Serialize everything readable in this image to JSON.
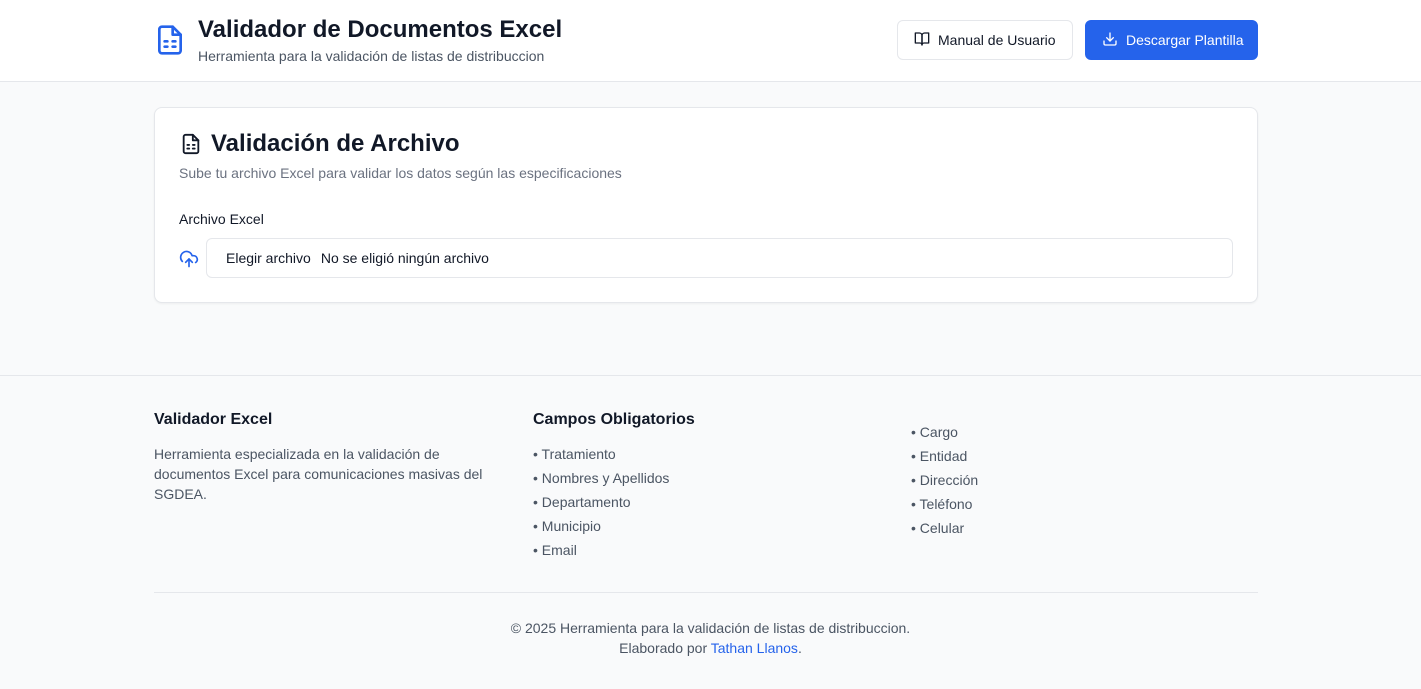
{
  "header": {
    "title": "Validador de Documentos Excel",
    "subtitle": "Herramienta para la validación de listas de distribuccion",
    "manual_button": "Manual de Usuario",
    "download_button": "Descargar Plantilla"
  },
  "card": {
    "title": "Validación de Archivo",
    "description": "Sube tu archivo Excel para validar los datos según las especificaciones",
    "field_label": "Archivo Excel",
    "file_button": "Elegir archivo",
    "file_status": "No se eligió ningún archivo"
  },
  "footer": {
    "about": {
      "heading": "Validador Excel",
      "text": "Herramienta especializada en la validación de documentos Excel para comunicaciones masivas del SGDEA."
    },
    "required": {
      "heading": "Campos Obligatorios",
      "items": [
        "• Tratamiento",
        "• Nombres y Apellidos",
        "• Departamento",
        "• Municipio",
        "• Email"
      ]
    },
    "more_fields": {
      "items": [
        "• Cargo",
        "• Entidad",
        "• Dirección",
        "• Teléfono",
        "• Celular"
      ]
    },
    "copyright": "© 2025 Herramienta para la validación de listas de distribuccion.",
    "credit_prefix": "Elaborado por",
    "credit_name": "Tathan Llanos",
    "credit_suffix": "."
  },
  "colors": {
    "accent": "#2563eb",
    "background": "#f9fafb",
    "border": "#e5e7eb",
    "muted_text": "#4b5563"
  },
  "icons": {
    "logo": "file-spreadsheet-icon",
    "manual": "book-open-icon",
    "download": "download-icon",
    "card": "file-text-icon",
    "upload": "cloud-upload-icon"
  }
}
